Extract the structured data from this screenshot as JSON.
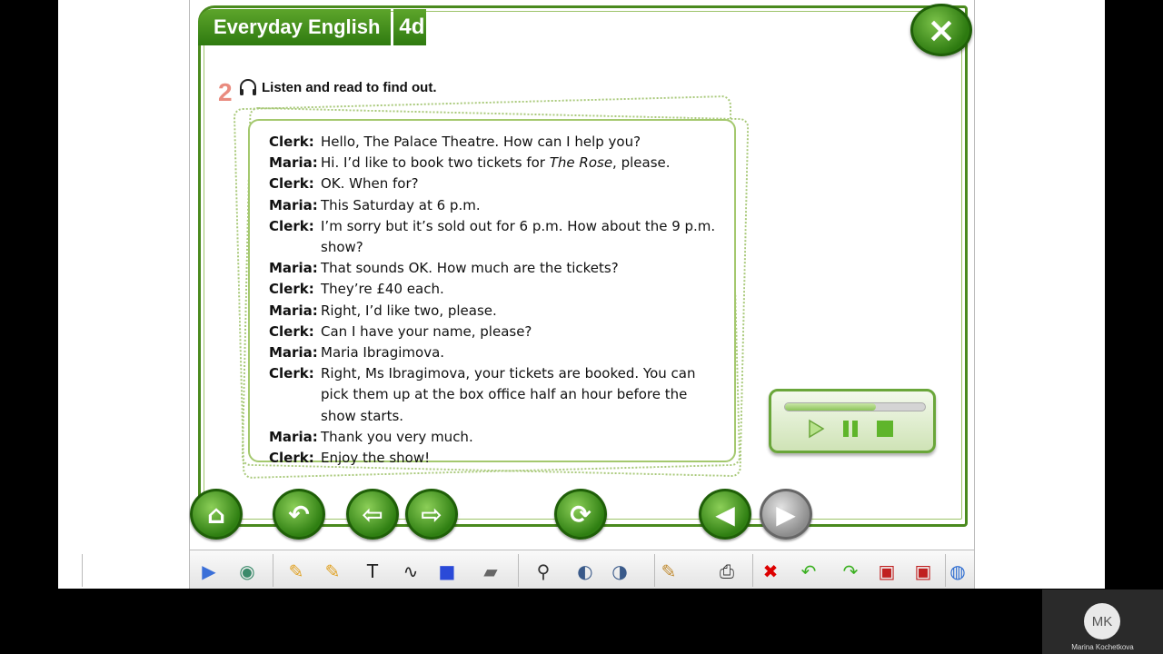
{
  "lesson": {
    "title": "Everyday English",
    "unit": "4d",
    "close_icon": "×"
  },
  "task": {
    "number": "2",
    "instruction": "Listen and read to find out."
  },
  "dialogue": [
    {
      "speaker": "Clerk:",
      "text": "Hello, The Palace Theatre. How can I help you?"
    },
    {
      "speaker": "Maria:",
      "text_before": "Hi. I’d like to book two tickets for ",
      "text_italic": "The Rose",
      "text_after": ", please."
    },
    {
      "speaker": "Clerk:",
      "text": "OK. When for?"
    },
    {
      "speaker": "Maria:",
      "text": "This Saturday at 6 p.m."
    },
    {
      "speaker": "Clerk:",
      "text": "I’m sorry but it’s sold out for 6 p.m. How about the 9 p.m. show?"
    },
    {
      "speaker": "Maria:",
      "text": "That sounds OK. How much are the tickets?"
    },
    {
      "speaker": "Clerk:",
      "text": "They’re £40 each."
    },
    {
      "speaker": "Maria:",
      "text": "Right, I’d like two, please."
    },
    {
      "speaker": "Clerk:",
      "text": "Can I have your name, please?"
    },
    {
      "speaker": "Maria:",
      "text": "Maria Ibragimova."
    },
    {
      "speaker": "Clerk:",
      "text": "Right, Ms Ibragimova, your tickets are booked. You can pick them up at the box office half an hour before the show starts."
    },
    {
      "speaker": "Maria:",
      "text": "Thank you very much."
    },
    {
      "speaker": "Clerk:",
      "text": "Enjoy the show!"
    }
  ],
  "player": {
    "progress": 0.65,
    "play_icon": "play-icon",
    "pause_icon": "pause-icon",
    "stop_icon": "stop-icon"
  },
  "nav": {
    "home_icon": "⌂",
    "back_icon": "↶",
    "prev_icon": "⇦",
    "next_icon": "⇨",
    "refresh_icon": "⟳",
    "page_prev_icon": "◀",
    "page_next_icon": "▶"
  },
  "toolbar": {
    "items": [
      {
        "name": "expand-icon",
        "glyph": "▶"
      },
      {
        "name": "pointer-icon",
        "glyph": "◉"
      },
      {
        "name": "pencil-icon",
        "glyph": "✎"
      },
      {
        "name": "highlighter-icon",
        "glyph": "✎"
      },
      {
        "name": "text-icon",
        "glyph": "T"
      },
      {
        "name": "freehand-icon",
        "glyph": "∿"
      },
      {
        "name": "shape-icon",
        "glyph": "■"
      },
      {
        "name": "eraser-icon",
        "glyph": "▰"
      },
      {
        "name": "zoom-icon",
        "glyph": "⚲"
      },
      {
        "name": "spotlight-icon",
        "glyph": "◐"
      },
      {
        "name": "reveal-icon",
        "glyph": "◑"
      },
      {
        "name": "notes-icon",
        "glyph": "✎"
      },
      {
        "name": "print-icon",
        "glyph": "⎙"
      },
      {
        "name": "clear-icon",
        "glyph": "✖"
      },
      {
        "name": "undo-icon",
        "glyph": "↶"
      },
      {
        "name": "redo-icon",
        "glyph": "↷"
      },
      {
        "name": "save-icon",
        "glyph": "▣"
      },
      {
        "name": "save-as-icon",
        "glyph": "▣"
      },
      {
        "name": "web-icon",
        "glyph": "◍"
      }
    ]
  },
  "meeting": {
    "initials": "MK",
    "participant_name": "Marina Kochetkova"
  },
  "colors": {
    "accent_green": "#4a8a1e",
    "task_number": "#e98b7f"
  }
}
